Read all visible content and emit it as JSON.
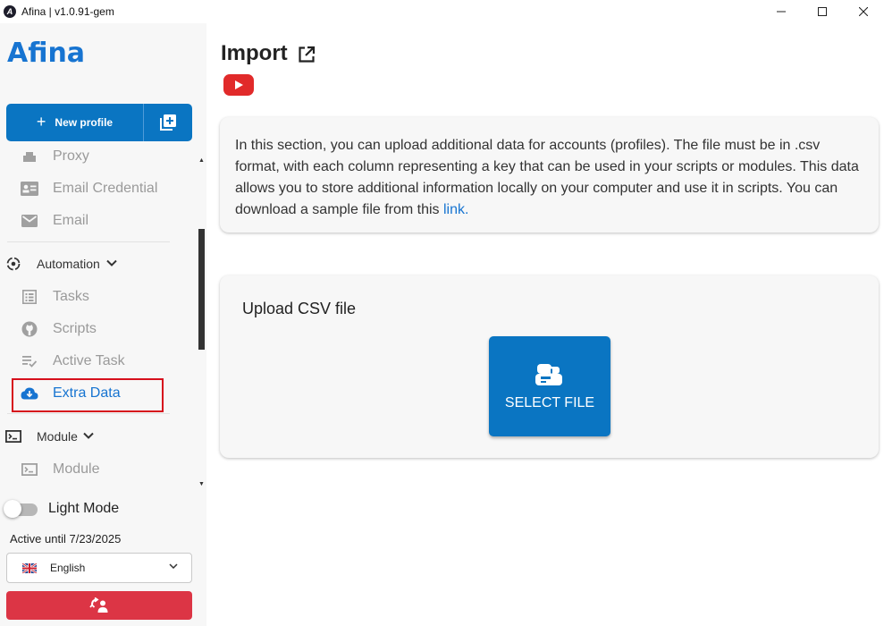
{
  "window": {
    "app_icon_letter": "A",
    "title": "Afina | v1.0.91-gem"
  },
  "sidebar": {
    "logo_text": "Afina",
    "new_profile_label": "New profile",
    "items": [
      {
        "key": "proxy",
        "label": "Proxy",
        "icon": "proxy-icon",
        "group": false
      },
      {
        "key": "email-credential",
        "label": "Email Credential",
        "icon": "id-card-icon",
        "group": false
      },
      {
        "key": "email",
        "label": "Email",
        "icon": "mail-icon",
        "group": false
      },
      {
        "key": "automation",
        "label": "Automation",
        "icon": "automation-icon",
        "group": true
      },
      {
        "key": "tasks",
        "label": "Tasks",
        "icon": "list-icon",
        "group": false
      },
      {
        "key": "scripts",
        "label": "Scripts",
        "icon": "github-icon",
        "group": false
      },
      {
        "key": "active-task",
        "label": "Active Task",
        "icon": "playlist-check-icon",
        "group": false
      },
      {
        "key": "extra-data",
        "label": "Extra Data",
        "icon": "cloud-download-icon",
        "group": false,
        "active": true
      },
      {
        "key": "module",
        "label": "Module",
        "icon": "terminal-icon",
        "group": true
      },
      {
        "key": "module-sub",
        "label": "Module",
        "icon": "terminal-icon",
        "group": false
      }
    ],
    "light_mode_label": "Light Mode",
    "active_until": "Active until 7/23/2025",
    "language": "English"
  },
  "main": {
    "title": "Import",
    "info_text": "In this section, you can upload additional data for accounts (profiles). The file must be in .csv format, with each column representing a key that can be used in your scripts or modules. This data allows you to store additional information locally on your computer and use it in scripts. You can download a sample file from this ",
    "info_link": "link.",
    "upload_title": "Upload CSV file",
    "select_file_label": "SELECT FILE"
  },
  "colors": {
    "accent": "#0a75c2",
    "active_text": "#1774d1",
    "danger": "#dc3545",
    "youtube": "#e12a2a"
  }
}
